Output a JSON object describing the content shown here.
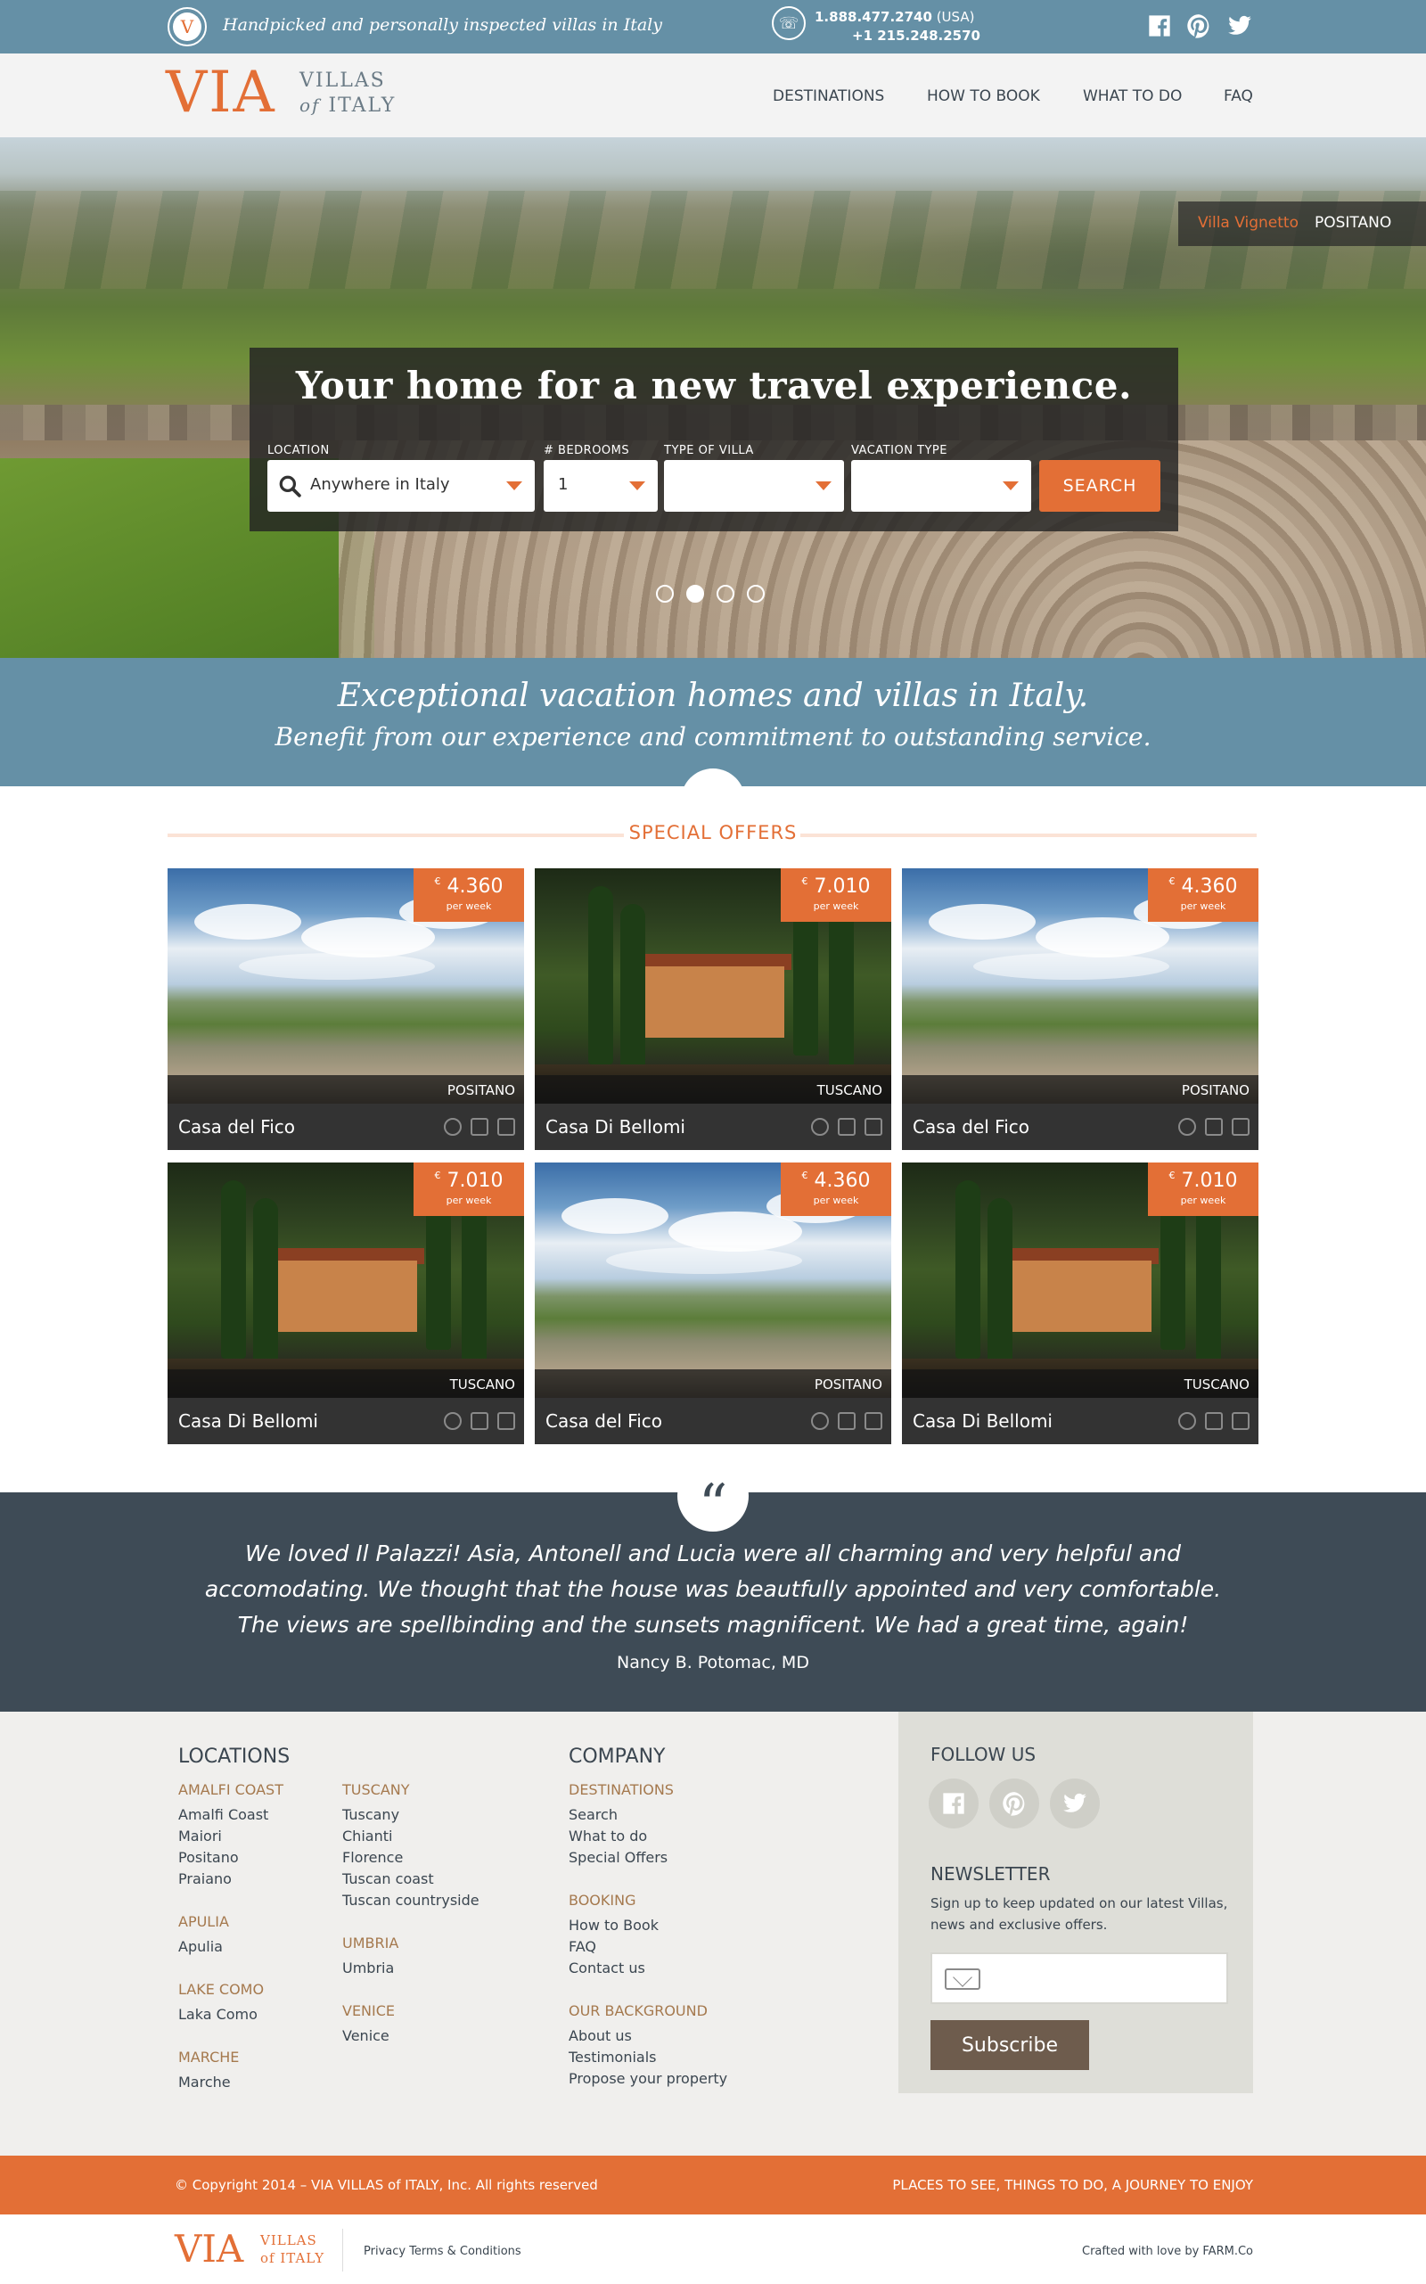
{
  "topbar": {
    "badge_letter": "V",
    "tagline": "Handpicked and personally inspected villas in Italy",
    "phone_usa_number": "1.888.477.2740",
    "phone_usa_suffix": "(USA)",
    "phone_intl": "+1 215.248.2570"
  },
  "nav": {
    "logo_main": "VIA",
    "logo_villas": "VILLAS",
    "logo_of": "of",
    "logo_italy": "ITALY",
    "links": [
      "DESTINATIONS",
      "HOW TO BOOK",
      "WHAT TO DO",
      "FAQ"
    ]
  },
  "hero": {
    "villa_name": "Villa Vignetto",
    "villa_location": "POSITANO",
    "title": "Your home for a new travel experience.",
    "labels": {
      "location": "LOCATION",
      "bedrooms": "# BEDROOMS",
      "type": "TYPE OF VILLA",
      "vacation": "VACATION TYPE"
    },
    "location_value": "Anywhere in Italy",
    "bedrooms_value": "1",
    "type_value": "",
    "vacation_value": "",
    "search_label": "SEARCH",
    "slides_total": 4,
    "slide_active": 2
  },
  "intro": {
    "line1": "Exceptional vacation homes and villas in Italy.",
    "line2": "Benefit from our experience and commitment to outstanding service."
  },
  "offers": {
    "title": "SPECIAL OFFERS",
    "currency": "€",
    "per_week": "per week",
    "cards": [
      {
        "price": "4.360",
        "region": "POSITANO",
        "name": "Casa del Fico",
        "photo": "landscape"
      },
      {
        "price": "7.010",
        "region": "TUSCANO",
        "name": "Casa Di Bellomi",
        "photo": "villa"
      },
      {
        "price": "4.360",
        "region": "POSITANO",
        "name": "Casa del Fico",
        "photo": "landscape"
      },
      {
        "price": "7.010",
        "region": "TUSCANO",
        "name": "Casa Di Bellomi",
        "photo": "villa"
      },
      {
        "price": "4.360",
        "region": "POSITANO",
        "name": "Casa del Fico",
        "photo": "landscape"
      },
      {
        "price": "7.010",
        "region": "TUSCANO",
        "name": "Casa Di Bellomi",
        "photo": "villa"
      }
    ]
  },
  "testimonial": {
    "lines": [
      "We loved Il Palazzi! Asia, Antonell and Lucia were all charming and very helpful and",
      "accomodating. We thought that the house was beautfully appointed and very comfortable.",
      "The views are spellbinding and the sunsets magnificent. We had a great time, again!"
    ],
    "author": "Nancy B. Potomac, MD"
  },
  "footer": {
    "locations_title": "LOCATIONS",
    "col1": [
      {
        "title": "AMALFI COAST",
        "items": [
          "Amalfi Coast",
          "Maiori",
          "Positano",
          "Praiano"
        ]
      },
      {
        "title": "APULIA",
        "items": [
          "Apulia"
        ]
      },
      {
        "title": "LAKE COMO",
        "items": [
          "Laka Como"
        ]
      },
      {
        "title": "MARCHE",
        "items": [
          "Marche"
        ]
      }
    ],
    "col2": [
      {
        "title": "TUSCANY",
        "items": [
          "Tuscany",
          "Chianti",
          "Florence",
          "Tuscan coast",
          "Tuscan countryside"
        ]
      },
      {
        "title": "UMBRIA",
        "items": [
          "Umbria"
        ]
      },
      {
        "title": "VENICE",
        "items": [
          "Venice"
        ]
      }
    ],
    "company_title": "COMPANY",
    "col3": [
      {
        "title": "DESTINATIONS",
        "items": [
          "Search",
          "What to do",
          "Special Offers"
        ]
      },
      {
        "title": "BOOKING",
        "items": [
          "How to Book",
          "FAQ",
          "Contact us"
        ]
      },
      {
        "title": "OUR BACKGROUND",
        "items": [
          "About us",
          "Testimonials",
          "Propose your property"
        ]
      }
    ],
    "follow_title": "FOLLOW US",
    "newsletter_title": "NEWSLETTER",
    "newsletter_text1": "Sign up to keep updated on our latest Villas,",
    "newsletter_text2": "news and exclusive offers.",
    "email_placeholder": "",
    "subscribe_label": "Subscribe"
  },
  "bottom": {
    "copyright": "© Copyright 2014 – VIA VILLAS of ITALY, Inc. All rights reserved",
    "tagline": "PLACES TO SEE, THINGS TO DO, A JOURNEY TO ENJOY",
    "logo_main": "VIA",
    "logo_villas": "VILLAS",
    "logo_italy": "of ITALY",
    "terms": "Privacy Terms & Conditions",
    "credit": "Crafted with love by FARM.Co"
  },
  "colors": {
    "accent": "#e36f36",
    "band": "#6590a6",
    "dark": "#3e4b56",
    "footer_bg": "#f0efed"
  }
}
